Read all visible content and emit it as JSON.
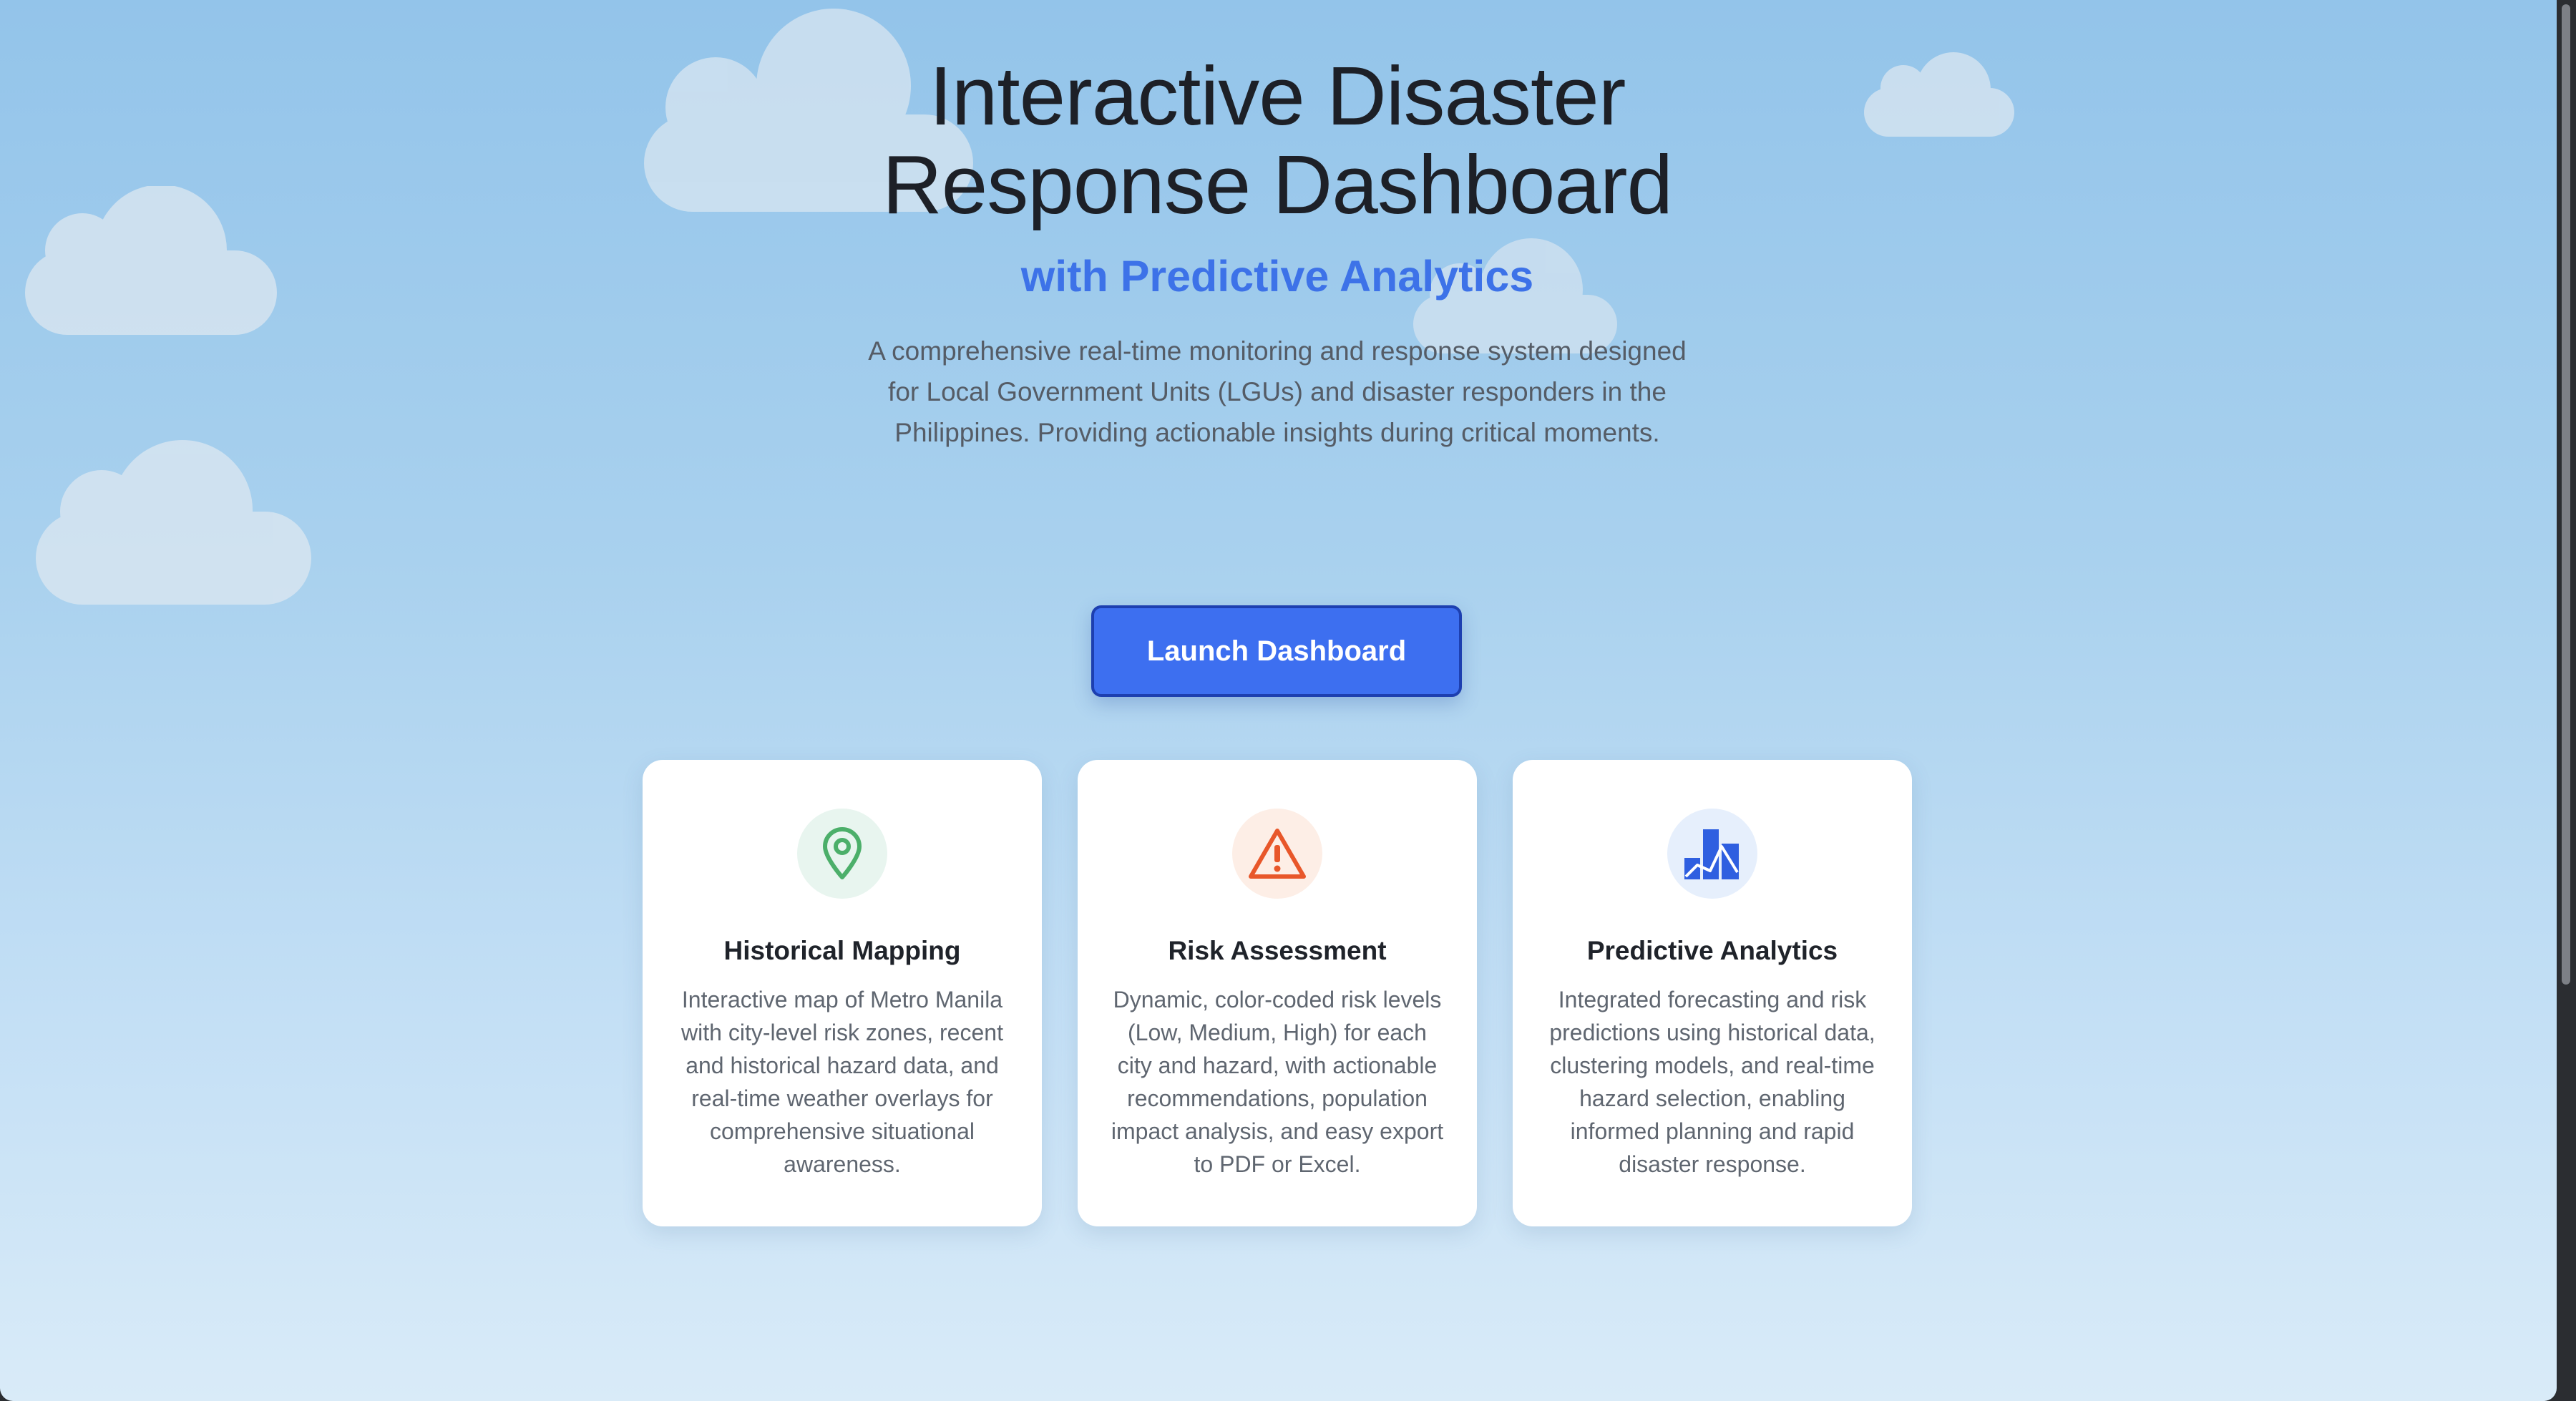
{
  "hero": {
    "title": "Interactive Disaster Response Dashboard",
    "subtitle": "with Predictive Analytics",
    "description": "A comprehensive real-time monitoring and response system designed for Local Government Units (LGUs) and disaster responders in the Philippines. Providing actionable insights during critical moments."
  },
  "cta": {
    "label": "Launch Dashboard"
  },
  "features": [
    {
      "icon": "map-pin-icon",
      "title": "Historical Mapping",
      "text": "Interactive map of Metro Manila with city-level risk zones, recent and historical hazard data, and real-time weather overlays for comprehensive situational awareness."
    },
    {
      "icon": "warning-triangle-icon",
      "title": "Risk Assessment",
      "text": "Dynamic, color-coded risk levels (Low, Medium, High) for each city and hazard, with actionable recommendations, population impact analysis, and easy export to PDF or Excel."
    },
    {
      "icon": "bar-chart-icon",
      "title": "Predictive Analytics",
      "text": "Integrated forecasting and risk predictions using historical data, clustering models, and real-time hazard selection, enabling informed planning and rapid disaster response."
    }
  ],
  "colors": {
    "accent": "#3d72e8",
    "button": "#3d6ff0",
    "mapping_icon": "#4caf6a",
    "risk_icon": "#e8572a",
    "analytics_icon": "#2f5fe0"
  }
}
